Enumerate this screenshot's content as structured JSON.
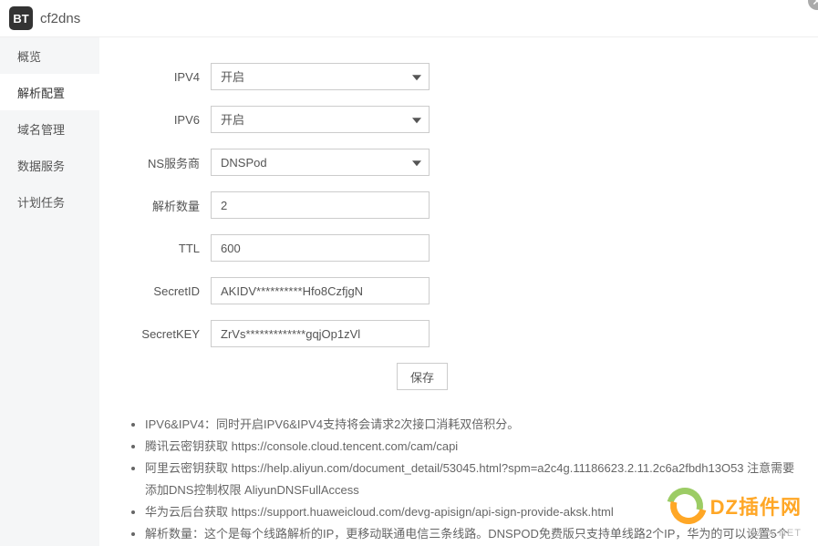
{
  "header": {
    "logo_text": "BT",
    "app_name": "cf2dns"
  },
  "sidebar": {
    "items": [
      {
        "label": "概览",
        "active": false
      },
      {
        "label": "解析配置",
        "active": true
      },
      {
        "label": "域名管理",
        "active": false
      },
      {
        "label": "数据服务",
        "active": false
      },
      {
        "label": "计划任务",
        "active": false
      }
    ]
  },
  "form": {
    "ipv4": {
      "label": "IPV4",
      "value": "开启"
    },
    "ipv6": {
      "label": "IPV6",
      "value": "开启"
    },
    "ns_provider": {
      "label": "NS服务商",
      "value": "DNSPod"
    },
    "resolve_count": {
      "label": "解析数量",
      "value": "2"
    },
    "ttl": {
      "label": "TTL",
      "value": "600"
    },
    "secret_id": {
      "label": "SecretID",
      "value": "AKIDV**********Hfo8CzfjgN"
    },
    "secret_key": {
      "label": "SecretKEY",
      "value": "ZrVs*************gqjOp1zVl"
    },
    "submit_label": "保存"
  },
  "help": {
    "items": [
      "IPV6&IPV4：同时开启IPV6&IPV4支持将会请求2次接口消耗双倍积分。",
      "腾讯云密钥获取 https://console.cloud.tencent.com/cam/capi",
      "阿里云密钥获取 https://help.aliyun.com/document_detail/53045.html?spm=a2c4g.11186623.2.11.2c6a2fbdh13O53 注意需要添加DNS控制权限 AliyunDNSFullAccess",
      "华为云后台获取 https://support.huaweicloud.com/devg-apisign/api-sign-provide-aksk.html",
      "解析数量：这个是每个线路解析的IP，更移动联通电信三条线路。DNSPOD免费版只支持单线路2个IP，华为的可以设置5个"
    ]
  },
  "watermark": {
    "text": "DZ插件网",
    "sub": "DZ-X.NET"
  }
}
